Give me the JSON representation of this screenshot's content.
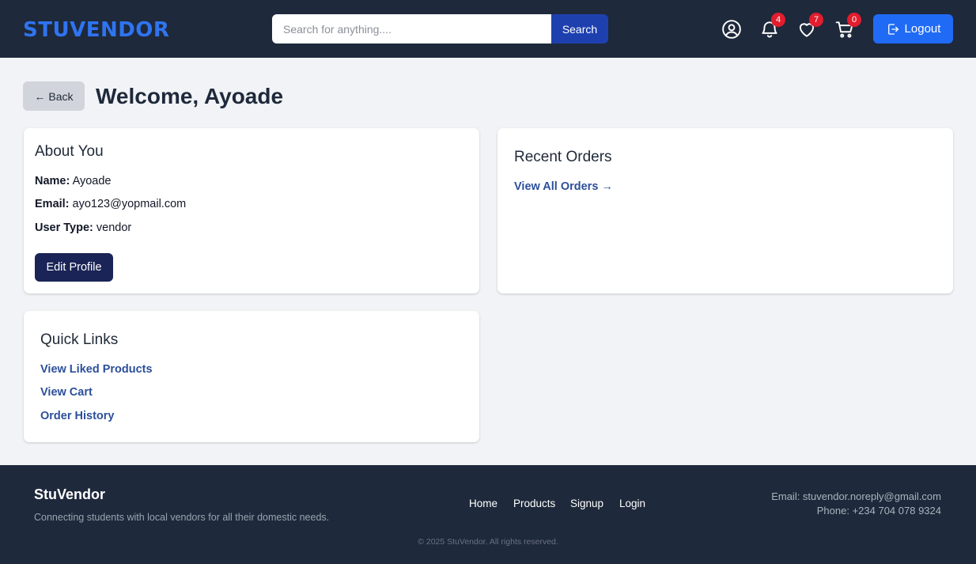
{
  "header": {
    "brand": "STUVENDOR",
    "search_placeholder": "Search for anything....",
    "search_button": "Search",
    "notifications_count": "4",
    "wishlist_count": "7",
    "cart_count": "0",
    "logout_label": "Logout"
  },
  "page": {
    "back_label": "← Back",
    "title": "Welcome, Ayoade"
  },
  "about": {
    "heading": "About You",
    "name_label": "Name:",
    "name_value": "Ayoade",
    "email_label": "Email:",
    "email_value": "ayo123@yopmail.com",
    "usertype_label": "User Type:",
    "usertype_value": "vendor",
    "edit_button": "Edit Profile"
  },
  "orders": {
    "heading": "Recent Orders",
    "view_all": "View All Orders →"
  },
  "quick_links": {
    "heading": "Quick Links",
    "items": [
      "View Liked Products",
      "View Cart",
      "Order History"
    ]
  },
  "footer": {
    "brand": "StuVendor",
    "tagline": "Connecting students with local vendors for all their domestic needs.",
    "nav": [
      "Home",
      "Products",
      "Signup",
      "Login"
    ],
    "email": "Email: stuvendor.noreply@gmail.com",
    "phone": "Phone: +234 704 078 9324",
    "copyright": "© 2025 StuVendor. All rights reserved."
  },
  "colors": {
    "header_bg": "#1e293b",
    "brand": "#2f74f0",
    "primary_button": "#1f6bf5",
    "search_button": "#1e40af",
    "edit_button": "#1a2456",
    "badge": "#e11d2e",
    "link": "#2c4f9a"
  },
  "icons": [
    "user-circle-icon",
    "bell-icon",
    "heart-icon",
    "cart-icon",
    "logout-icon"
  ]
}
